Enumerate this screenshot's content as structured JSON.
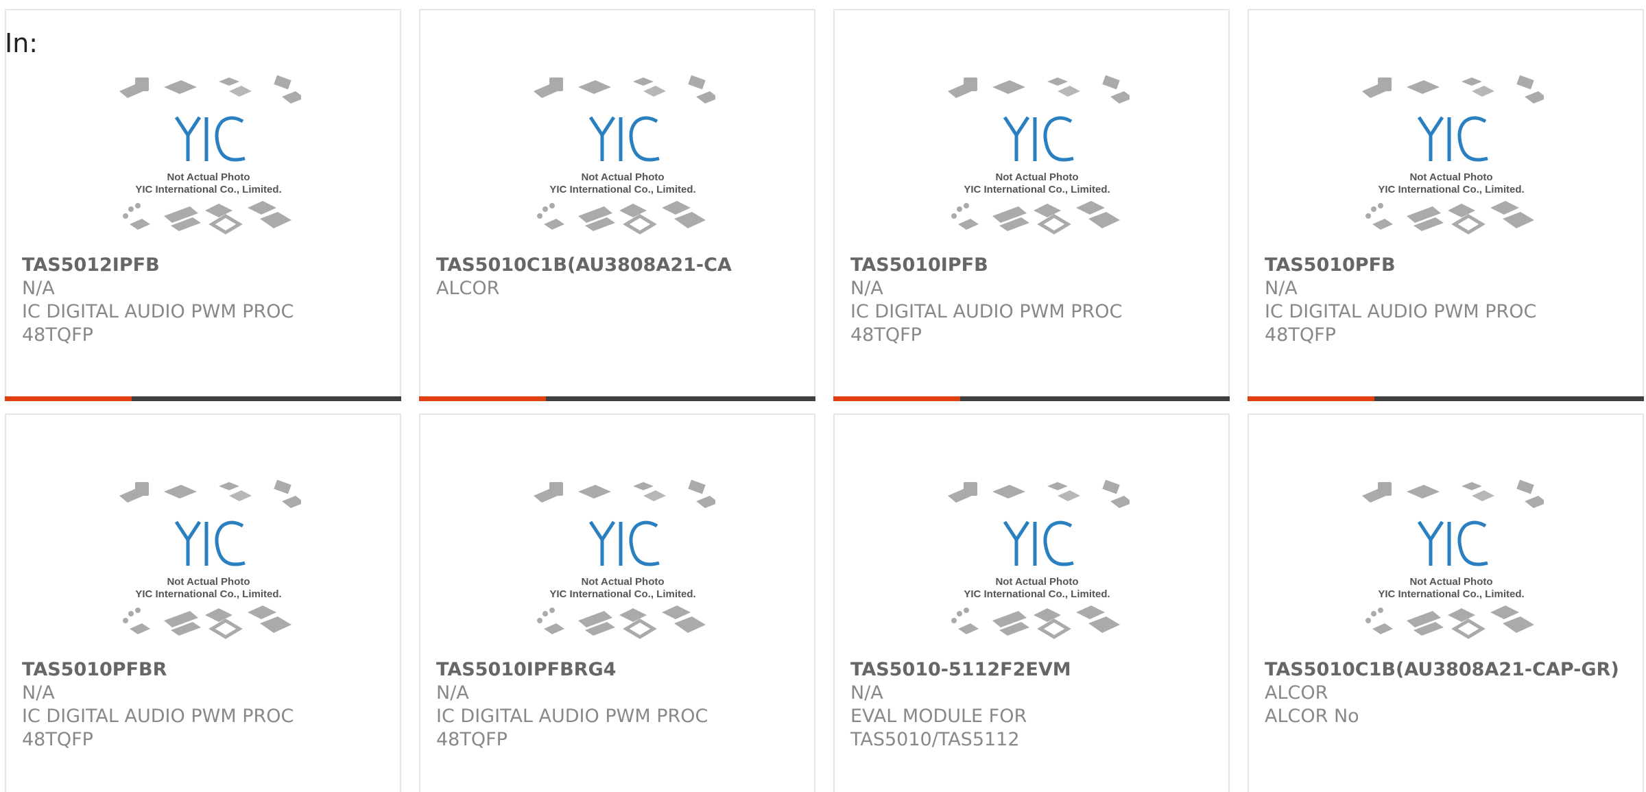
{
  "header": {
    "label": "In:"
  },
  "colors": {
    "accent": "#e0400f",
    "bar": "#404040",
    "title": "#666666",
    "text": "#888888",
    "logo": "#2a7fc0",
    "chip": "#aaaaaa"
  },
  "placeholder_image": {
    "logo_text": "YIC",
    "caption_line1": "Not Actual Photo",
    "caption_line2": "YIC International Co., Limited."
  },
  "products": [
    {
      "part_number": "TAS5012IPFB",
      "manufacturer": "N/A",
      "desc1": "IC DIGITAL AUDIO PWM PROC",
      "desc2": "48TQFP",
      "progress": 0.32
    },
    {
      "part_number": "TAS5010C1B(AU3808A21-CA",
      "manufacturer": "ALCOR",
      "desc1": "",
      "desc2": "",
      "progress": 0.32
    },
    {
      "part_number": "TAS5010IPFB",
      "manufacturer": "N/A",
      "desc1": "IC DIGITAL AUDIO PWM PROC",
      "desc2": "48TQFP",
      "progress": 0.32
    },
    {
      "part_number": "TAS5010PFB",
      "manufacturer": "N/A",
      "desc1": "IC DIGITAL AUDIO PWM PROC",
      "desc2": "48TQFP",
      "progress": 0.32
    },
    {
      "part_number": "TAS5010PFBR",
      "manufacturer": "N/A",
      "desc1": "IC DIGITAL AUDIO PWM PROC",
      "desc2": "48TQFP"
    },
    {
      "part_number": "TAS5010IPFBRG4",
      "manufacturer": "N/A",
      "desc1": "IC DIGITAL AUDIO PWM PROC",
      "desc2": "48TQFP"
    },
    {
      "part_number": "TAS5010-5112F2EVM",
      "manufacturer": "N/A",
      "desc1": "EVAL MODULE FOR",
      "desc2": "TAS5010/TAS5112"
    },
    {
      "part_number": "TAS5010C1B(AU3808A21-CAP-GR)",
      "manufacturer": "ALCOR",
      "desc1": "ALCOR No",
      "desc2": ""
    }
  ]
}
